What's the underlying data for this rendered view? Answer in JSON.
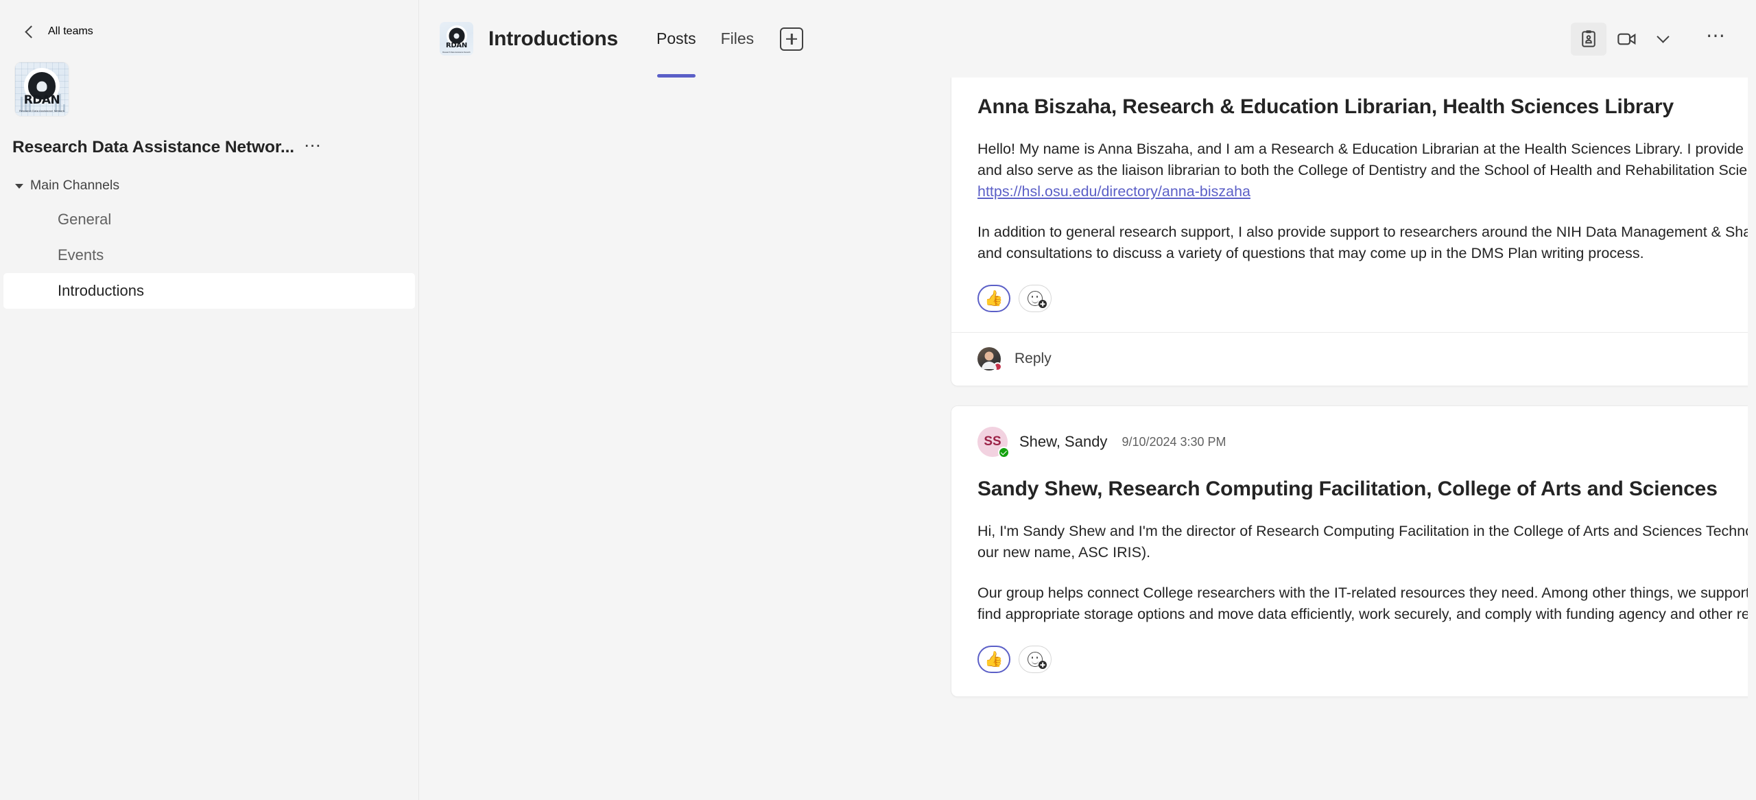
{
  "sidebar": {
    "back_label": "All teams",
    "back_icon": "chevron-left-icon",
    "team": {
      "logo_text": "RDAN",
      "logo_subtext": "Research Data Assistance Network",
      "name": "Research Data Assistance Networ...",
      "more_icon": "ellipsis-icon"
    },
    "group": {
      "label": "Main Channels",
      "expand_icon": "chevron-down-icon"
    },
    "channels": [
      {
        "label": "General",
        "active": false
      },
      {
        "label": "Events",
        "active": false
      },
      {
        "label": "Introductions",
        "active": true
      }
    ]
  },
  "header": {
    "channel_avatar_text": "RDAN",
    "channel_avatar_subtext": "Research Data Assistance Network",
    "title": "Introductions",
    "tabs": [
      {
        "label": "Posts",
        "active": true
      },
      {
        "label": "Files",
        "active": false
      }
    ],
    "add_tab_icon": "plus-icon",
    "actions": [
      {
        "icon": "notes-clipboard-icon",
        "selected": true
      },
      {
        "icon": "video-camera-icon",
        "selected": false
      },
      {
        "icon": "chevron-down-icon",
        "selected": false
      },
      {
        "icon": "more-options-icon",
        "selected": false
      }
    ]
  },
  "feed": {
    "posts": [
      {
        "id": "post-anna-biszaha",
        "has_header": false,
        "title": "Anna Biszaha, Research & Education Librarian, Health Sciences Library",
        "paragraph1_before_link": "Hello!  My name is Anna Biszaha, and I am a Research & Education Librarian at the Health Sciences Library.  I provide reference, instruction and research support services and also serve as the liaison librarian to both the College of Dentistry and the School of Health and Rehabilitation Sciences.  You can find my profile page here: ",
        "paragraph1_link": "https://hsl.osu.edu/directory/anna-biszaha",
        "paragraph2": "In addition to general research support, I also provide support to researchers around the NIH Data Management & Sharing Policy, including providing DMS Plan reviews and consultations to discuss a variety of questions that may come up in the DMS Plan writing process.",
        "reaction": "👍",
        "reaction_name": "thumbs-up-reaction",
        "add_reaction_icon": "add-reaction-icon",
        "reply_label": "Reply",
        "has_reply_row": true
      },
      {
        "id": "post-sandy-shew",
        "has_header": true,
        "author": "Shew, Sandy",
        "author_initials": "SS",
        "presence": "available",
        "timestamp": "9/10/2024 3:30 PM",
        "title": "Sandy Shew, Research Computing Facilitation, College of Arts and Sciences",
        "paragraph1": "Hi, I'm Sandy Shew and I'm the director of Research Computing Facilitation in the College of Arts and Sciences Technology Services group (more concisely, ASCTech, or our new name, ASC IRIS).",
        "paragraph2": "Our group helps connect College researchers with the IT-related resources they need. Among other things, we support users of the College's HPC cluster, help researchers find appropriate storage options and move data efficiently, work securely, and comply with funding agency and other regulations.",
        "reaction": "👍",
        "reaction_name": "thumbs-up-reaction",
        "add_reaction_icon": "add-reaction-icon",
        "has_reply_row": false
      }
    ]
  },
  "colors": {
    "accent_purple": "#5b5fc7",
    "sidebar_bg": "#f4f4f4",
    "main_bg": "#f5f5f5",
    "card_bg": "#ffffff",
    "text_primary": "#242424",
    "text_secondary": "#616161",
    "presence_green": "#13a10e",
    "avatar_pink_bg": "#f2d2e0",
    "avatar_pink_fg": "#9b2247"
  }
}
